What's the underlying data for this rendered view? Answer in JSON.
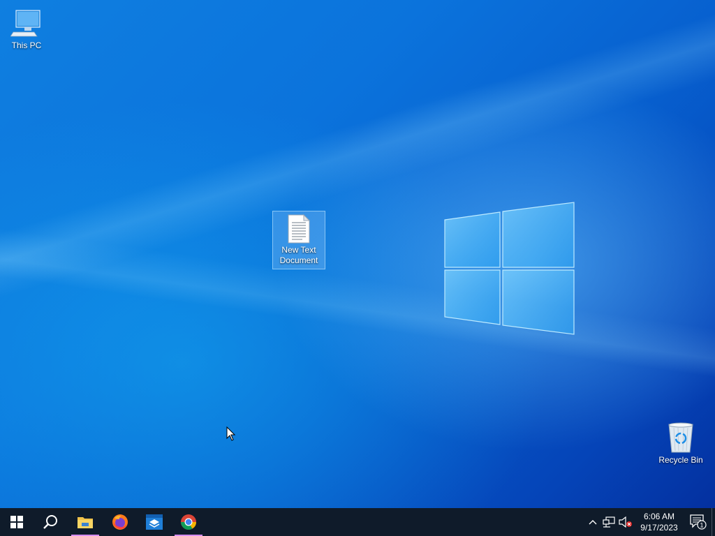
{
  "desktop": {
    "icons": [
      {
        "label": "This PC",
        "icon": "computer-icon"
      },
      {
        "label": "New Text Document",
        "label_line1": "New Text",
        "label_line2": "Document",
        "icon": "text-document-icon",
        "selected": true
      },
      {
        "label": "Recycle Bin",
        "icon": "recycle-bin-icon"
      }
    ],
    "wallpaper": "windows-10-default",
    "accent": "#0a6fd6"
  },
  "taskbar": {
    "background": "#0f1b2a",
    "buttons": [
      {
        "name": "Start",
        "icon": "windows-start-icon"
      },
      {
        "name": "Search",
        "icon": "search-icon"
      },
      {
        "name": "File Explorer",
        "icon": "folder-icon",
        "active": true
      },
      {
        "name": "Firefox",
        "icon": "firefox-icon"
      },
      {
        "name": "App",
        "icon": "app-window-icon"
      },
      {
        "name": "Chrome",
        "icon": "chrome-icon",
        "active": true
      }
    ],
    "tray": {
      "time": "6:06 AM",
      "date": "9/17/2023",
      "notification_count": "1",
      "icons": [
        "chevron-up-icon",
        "network-icon",
        "volume-muted-icon",
        "action-center-icon"
      ]
    },
    "active_indicator_color": "#d58cf0"
  }
}
